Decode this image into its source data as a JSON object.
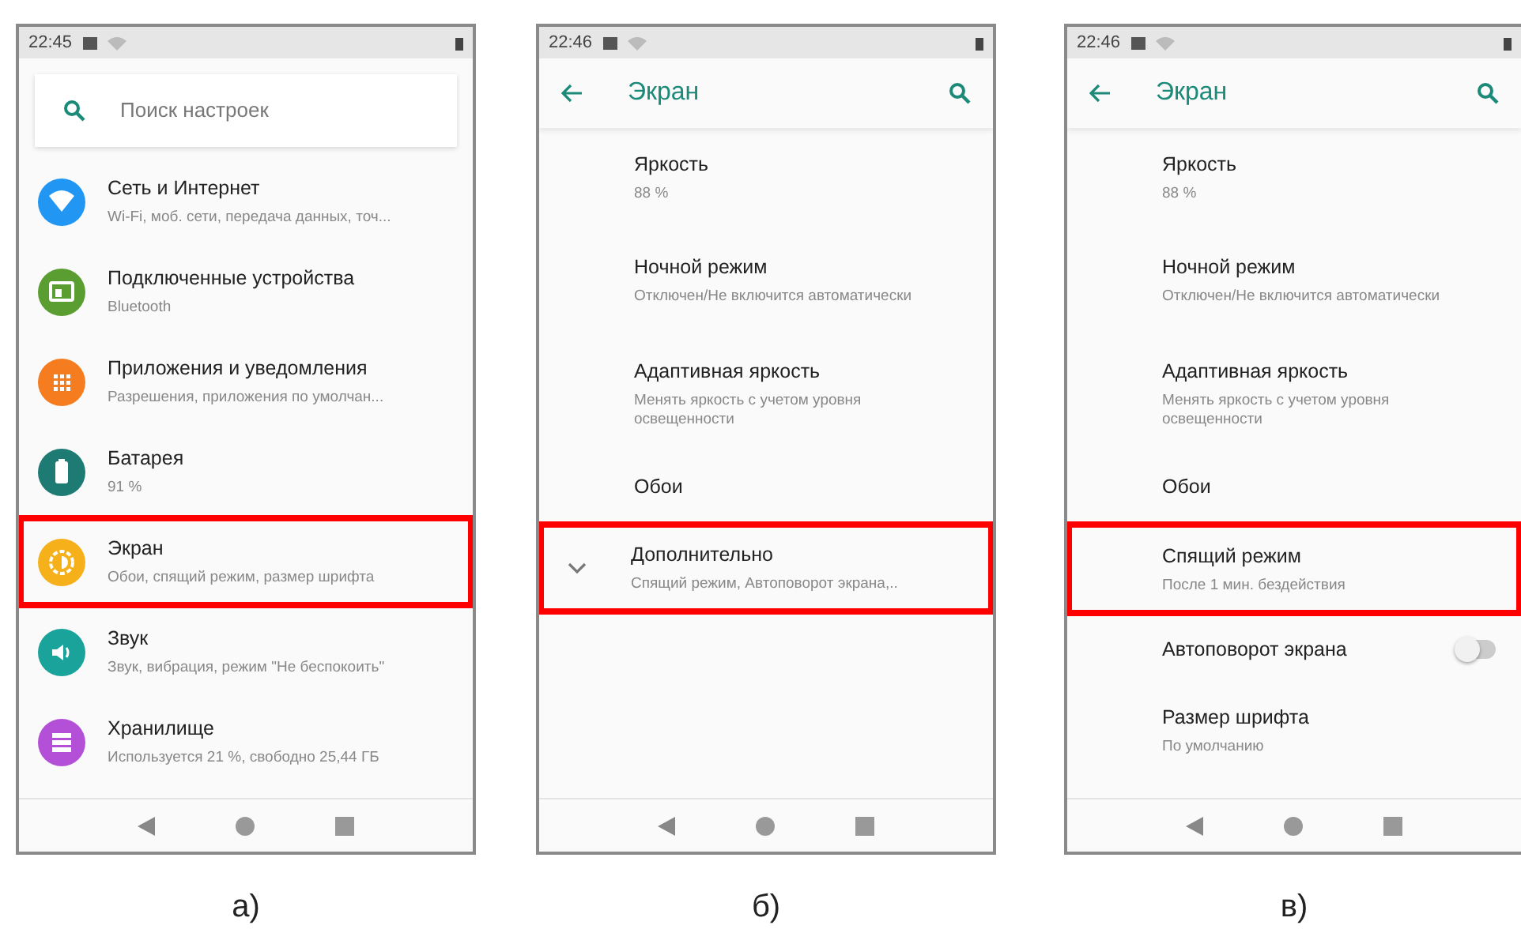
{
  "panels": [
    {
      "status_bar": {
        "time": "22:45"
      },
      "search": {
        "placeholder": "Поиск настроек"
      },
      "items": [
        {
          "kind": "icon_item",
          "color": "#2196f3",
          "title": "Сеть и Интернет",
          "subtitle": "Wi-Fi, моб. сети, передача данных, точ...",
          "highlighted": false
        },
        {
          "kind": "icon_item",
          "color": "#5a9e32",
          "title": "Подключенные устройства",
          "subtitle": "Bluetooth",
          "highlighted": false
        },
        {
          "kind": "icon_item",
          "color": "#f57c1f",
          "title": "Приложения и уведомления",
          "subtitle": "Разрешения, приложения по умолчан...",
          "highlighted": false
        },
        {
          "kind": "icon_item",
          "color": "#1e7b74",
          "title": "Батарея",
          "subtitle": "91 %",
          "highlighted": false
        },
        {
          "kind": "icon_item",
          "color": "#f5b01a",
          "title": "Экран",
          "subtitle": "Обои, спящий режим, размер шрифта",
          "highlighted": true
        },
        {
          "kind": "icon_item",
          "color": "#1aa39a",
          "title": "Звук",
          "subtitle": "Звук, вибрация, режим \"Не беспокоить\"",
          "highlighted": false
        },
        {
          "kind": "icon_item",
          "color": "#b450d8",
          "title": "Хранилище",
          "subtitle": "Используется 21 %, свободно 25,44 ГБ",
          "highlighted": false
        }
      ],
      "caption": "а)"
    },
    {
      "status_bar": {
        "time": "22:46"
      },
      "toolbar": {
        "title": "Экран"
      },
      "items": [
        {
          "kind": "text_item",
          "title": "Яркость",
          "subtitle": "88 %",
          "highlighted": false
        },
        {
          "kind": "text_item",
          "title": "Ночной режим",
          "subtitle": "Отключен/Не включится автоматически",
          "highlighted": false
        },
        {
          "kind": "text_item",
          "title": "Адаптивная яркость",
          "subtitle": "Менять яркость с учетом уровня освещенности",
          "highlighted": false
        },
        {
          "kind": "text_item",
          "title": "Обои",
          "highlighted": false
        },
        {
          "kind": "expand_item",
          "title": "Дополнительно",
          "subtitle": "Спящий режим, Автоповорот экрана,..",
          "highlighted": true
        }
      ],
      "caption": "б)"
    },
    {
      "status_bar": {
        "time": "22:46"
      },
      "toolbar": {
        "title": "Экран"
      },
      "items": [
        {
          "kind": "text_item",
          "title": "Яркость",
          "subtitle": "88 %",
          "highlighted": false
        },
        {
          "kind": "text_item",
          "title": "Ночной режим",
          "subtitle": "Отключен/Не включится автоматически",
          "highlighted": false
        },
        {
          "kind": "text_item",
          "title": "Адаптивная яркость",
          "subtitle": "Менять яркость с учетом уровня освещенности",
          "highlighted": false
        },
        {
          "kind": "text_item",
          "title": "Обои",
          "highlighted": false
        },
        {
          "kind": "text_item",
          "title": "Спящий режим",
          "subtitle": "После 1 мин. бездействия",
          "highlighted": true
        },
        {
          "kind": "switch_item",
          "title": "Автоповорот экрана",
          "on": false,
          "highlighted": false
        },
        {
          "kind": "text_item",
          "title": "Размер шрифта",
          "subtitle": "По умолчанию",
          "highlighted": false
        }
      ],
      "caption": "в)"
    }
  ]
}
